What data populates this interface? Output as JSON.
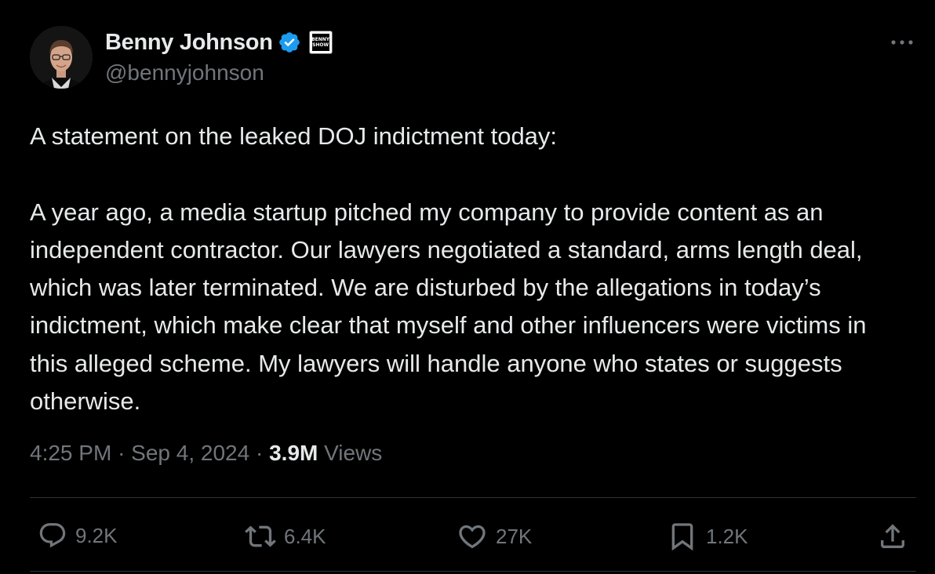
{
  "author": {
    "display_name": "Benny Johnson",
    "handle": "@bennyjohnson",
    "verified": true,
    "affiliate_badge_text": "BENNY SHOW",
    "avatar_icon": "profile-photo"
  },
  "tweet": {
    "text": "A statement on the leaked DOJ indictment today:\n\nA year ago, a media startup pitched my company to provide content as an independent contractor. Our lawyers negotiated a standard, arms length deal, which was later terminated. We are disturbed by the allegations in today’s indictment, which make clear that myself and other influencers were victims in this alleged scheme. My lawyers will handle anyone who states or suggests otherwise.",
    "time": "4:25 PM",
    "separator": "·",
    "date": "Sep 4, 2024",
    "views_count": "3.9M",
    "views_label": "Views"
  },
  "actions": {
    "replies": "9.2K",
    "reposts": "6.4K",
    "likes": "27K",
    "bookmarks": "1.2K"
  },
  "colors": {
    "background": "#000000",
    "text_primary": "#e7e9ea",
    "text_secondary": "#71767b",
    "verified_blue": "#1d9bf0",
    "divider": "#2f3336"
  },
  "icons": {
    "more": "more-horizontal-icon",
    "reply": "reply-icon",
    "repost": "repost-icon",
    "like": "heart-icon",
    "bookmark": "bookmark-icon",
    "share": "share-icon"
  }
}
